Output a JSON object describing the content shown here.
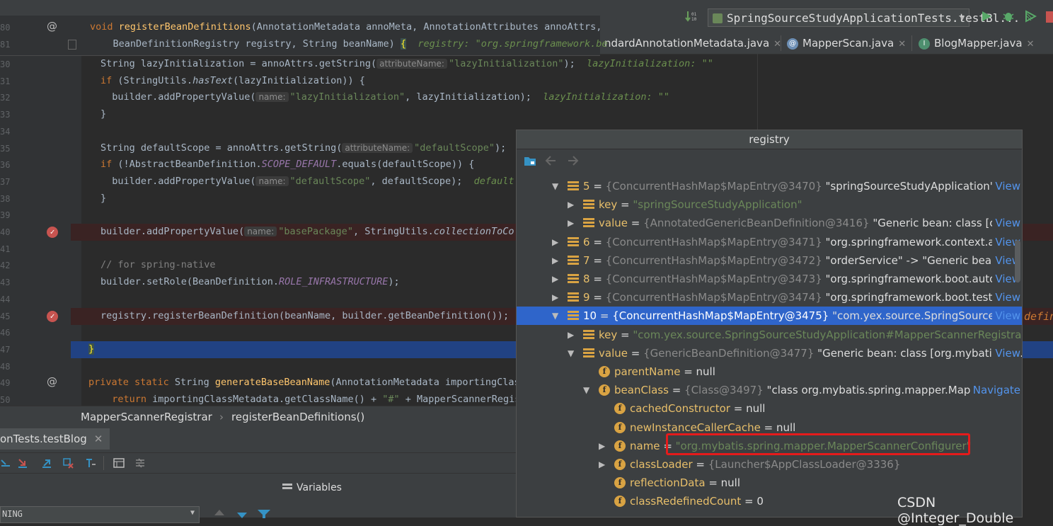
{
  "topbar": {
    "crumbs": "",
    "run_config": "SpringSourceStudyApplicationTests.testBl..."
  },
  "tabs": [
    {
      "label": "ndardAnnotationMetadata.java",
      "icon": ""
    },
    {
      "label": "MapperScan.java",
      "icon": "@"
    },
    {
      "label": "BlogMapper.java",
      "icon": "I"
    }
  ],
  "sticky": {
    "line1_num": "80",
    "line1": {
      "kw": "void",
      "name": "registerBeanDefinitions",
      "rest": "(AnnotationMetadata annoMeta, AnnotationAttributes annoAttrs,"
    },
    "line2_num": "81",
    "line2": {
      "code": "    BeanDefinitionRegistry registry, String beanName)",
      "brace": "{",
      "hint": "registry: \"org.springframework.be"
    }
  },
  "code": [
    {
      "num": "30",
      "parts": [
        [
          "plain",
          "String lazyInitialization = annoAttrs.getString("
        ],
        [
          "hint",
          "attributeName:"
        ],
        [
          "str",
          "\"lazyInitialization\""
        ],
        [
          "plain",
          ");  "
        ],
        [
          "inl",
          "lazyInitialization: \"\""
        ]
      ]
    },
    {
      "num": "31",
      "parts": [
        [
          "kw",
          "if"
        ],
        [
          "plain",
          " (StringUtils."
        ],
        [
          "it",
          "hasText"
        ],
        [
          "plain",
          "(lazyInitialization)) {"
        ]
      ]
    },
    {
      "num": "32",
      "parts": [
        [
          "plain",
          "  builder.addPropertyValue("
        ],
        [
          "hint",
          "name:"
        ],
        [
          "str",
          "\"lazyInitialization\""
        ],
        [
          "plain",
          ", lazyInitialization);  "
        ],
        [
          "inl",
          "lazyInitialization: \"\""
        ]
      ]
    },
    {
      "num": "33",
      "parts": [
        [
          "plain",
          "}"
        ]
      ]
    },
    {
      "num": "34",
      "parts": []
    },
    {
      "num": "35",
      "parts": [
        [
          "plain",
          "String defaultScope = annoAttrs.getString("
        ],
        [
          "hint",
          "attributeName:"
        ],
        [
          "str",
          "\"defaultScope\""
        ],
        [
          "plain",
          ");"
        ]
      ]
    },
    {
      "num": "36",
      "parts": [
        [
          "kw",
          "if"
        ],
        [
          "plain",
          " (!AbstractBeanDefinition."
        ],
        [
          "const",
          "SCOPE_DEFAULT"
        ],
        [
          "plain",
          ".equals(defaultScope)) {"
        ]
      ]
    },
    {
      "num": "37",
      "parts": [
        [
          "plain",
          "  builder.addPropertyValue("
        ],
        [
          "hint",
          "name:"
        ],
        [
          "str",
          "\"defaultScope\""
        ],
        [
          "plain",
          ", defaultScope);  "
        ],
        [
          "inl",
          "default"
        ]
      ]
    },
    {
      "num": "38",
      "parts": [
        [
          "plain",
          "}"
        ]
      ]
    },
    {
      "num": "39",
      "parts": []
    },
    {
      "num": "40",
      "parts": [
        [
          "plain",
          "builder.addPropertyValue("
        ],
        [
          "hint",
          "name:"
        ],
        [
          "str",
          "\"basePackage\""
        ],
        [
          "plain",
          ", StringUtils."
        ],
        [
          "it",
          "collectionToCo"
        ]
      ]
    },
    {
      "num": "41",
      "parts": []
    },
    {
      "num": "42",
      "parts": [
        [
          "cmt",
          "// for spring-native"
        ]
      ]
    },
    {
      "num": "43",
      "parts": [
        [
          "plain",
          "builder.setRole(BeanDefinition."
        ],
        [
          "const",
          "ROLE_INFRASTRUCTURE"
        ],
        [
          "plain",
          ");"
        ]
      ]
    },
    {
      "num": "44",
      "parts": []
    },
    {
      "num": "45",
      "parts": [
        [
          "plain",
          "registry.registerBeanDefinition(beanName, builder.getBeanDefinition());"
        ]
      ]
    },
    {
      "num": "46",
      "parts": []
    },
    {
      "num": "47",
      "parts": [
        [
          "plain",
          "}"
        ]
      ]
    },
    {
      "num": "48",
      "parts": []
    },
    {
      "num": "49",
      "parts": [
        [
          "kw",
          "private static"
        ],
        [
          "plain",
          " String "
        ],
        [
          "fn",
          "generateBaseBeanName"
        ],
        [
          "plain",
          "(AnnotationMetadata importingClass"
        ]
      ]
    },
    {
      "num": "50",
      "parts": [
        [
          "kw",
          "  return"
        ],
        [
          "plain",
          " importingClassMetadata.getClassName() + "
        ],
        [
          "str",
          "\"#\""
        ],
        [
          "plain",
          " + MapperScannerRegistra"
        ]
      ]
    }
  ],
  "breadcrumb": {
    "class_name": "MapperScannerRegistrar",
    "sep": "›",
    "method": "registerBeanDefinitions()"
  },
  "debug": {
    "tab_label": "onTests.testBlog",
    "variables_label": "Variables",
    "frame_text": "NING"
  },
  "popup": {
    "title": "registry",
    "rows": [
      {
        "indent": 0,
        "arrow": "down",
        "icon": "list",
        "num": "5",
        "type": "{ConcurrentHashMap$MapEntry@3470}",
        "value": "\"springSourceStudyApplication\" ...",
        "link": "View"
      },
      {
        "indent": 1,
        "arrow": "right",
        "icon": "list",
        "num": "key",
        "type": "",
        "value": "\"springSourceStudyApplication\"",
        "link": "",
        "valgreen": true
      },
      {
        "indent": 1,
        "arrow": "right",
        "icon": "list",
        "num": "value",
        "type": "{AnnotatedGenericBeanDefinition@3416}",
        "value": "\"Generic bean: class [com",
        "link": "View"
      },
      {
        "indent": 0,
        "arrow": "right",
        "icon": "list",
        "num": "6",
        "type": "{ConcurrentHashMap$MapEntry@3471}",
        "value": "\"org.springframework.context.an",
        "link": "View"
      },
      {
        "indent": 0,
        "arrow": "right",
        "icon": "list",
        "num": "7",
        "type": "{ConcurrentHashMap$MapEntry@3472}",
        "value": "\"orderService\" -> \"Generic bean: ...",
        "link": "View"
      },
      {
        "indent": 0,
        "arrow": "right",
        "icon": "list",
        "num": "8",
        "type": "{ConcurrentHashMap$MapEntry@3473}",
        "value": "\"org.springframework.boot.autoc",
        "link": "View"
      },
      {
        "indent": 0,
        "arrow": "right",
        "icon": "list",
        "num": "9",
        "type": "{ConcurrentHashMap$MapEntry@3474}",
        "value": "\"org.springframework.boot.test.r...",
        "link": "View"
      },
      {
        "indent": 0,
        "arrow": "down",
        "icon": "list",
        "num": "10",
        "type": "{ConcurrentHashMap$MapEntry@3475}",
        "value": "\"com.yex.source.SpringSourceS...",
        "link": "View",
        "selected": true
      },
      {
        "indent": 1,
        "arrow": "right",
        "icon": "list",
        "num": "key",
        "type": "",
        "value": "\"com.yex.source.SpringSourceStudyApplication#MapperScannerRegistrar#",
        "link": "",
        "valgreen": true
      },
      {
        "indent": 1,
        "arrow": "down",
        "icon": "list",
        "num": "value",
        "type": "{GenericBeanDefinition@3477}",
        "value": "\"Generic bean: class [org.mybatis.sp...",
        "link": "View"
      },
      {
        "indent": 2,
        "arrow": "",
        "icon": "field",
        "num": "parentName",
        "type": "",
        "value": "= null",
        "link": ""
      },
      {
        "indent": 2,
        "arrow": "down",
        "icon": "field",
        "num": "beanClass",
        "type": "{Class@3497}",
        "value": "\"class org.mybatis.spring.mapper.Mappe...",
        "link": "Navigate"
      },
      {
        "indent": 3,
        "arrow": "",
        "icon": "field",
        "num": "cachedConstructor",
        "type": "",
        "value": "= null",
        "link": ""
      },
      {
        "indent": 3,
        "arrow": "",
        "icon": "field",
        "num": "newInstanceCallerCache",
        "type": "",
        "value": "= null",
        "link": ""
      },
      {
        "indent": 3,
        "arrow": "right",
        "icon": "field",
        "num": "name",
        "type": "",
        "value": "\"org.mybatis.spring.mapper.MapperScannerConfigurer\"",
        "link": "",
        "valgreen": true
      },
      {
        "indent": 3,
        "arrow": "right",
        "icon": "field",
        "num": "classLoader",
        "type": "{Launcher$AppClassLoader@3336}",
        "value": "",
        "link": ""
      },
      {
        "indent": 3,
        "arrow": "",
        "icon": "field",
        "num": "reflectionData",
        "type": "",
        "value": "= null",
        "link": ""
      },
      {
        "indent": 3,
        "arrow": "",
        "icon": "field",
        "num": "classRedefinedCount",
        "type": "",
        "value": "= 0",
        "link": ""
      }
    ],
    "overflow_text": "defin"
  },
  "watermark": "CSDN @Integer_Double"
}
